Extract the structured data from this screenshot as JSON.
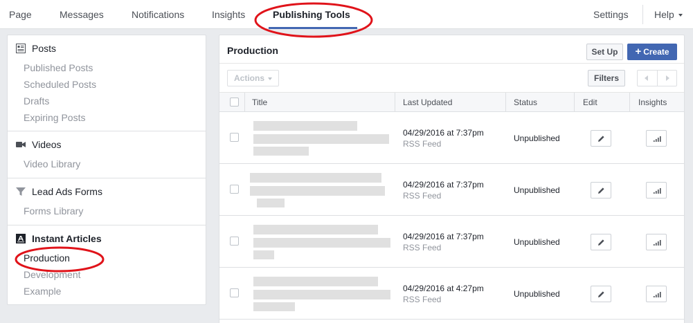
{
  "nav": {
    "page": "Page",
    "messages": "Messages",
    "notifications": "Notifications",
    "insights": "Insights",
    "publishing_tools": "Publishing Tools",
    "settings": "Settings",
    "help": "Help"
  },
  "sidebar": {
    "posts": {
      "title": "Posts",
      "items": [
        "Published Posts",
        "Scheduled Posts",
        "Drafts",
        "Expiring Posts"
      ]
    },
    "videos": {
      "title": "Videos",
      "items": [
        "Video Library"
      ]
    },
    "lead_ads": {
      "title": "Lead Ads Forms",
      "items": [
        "Forms Library"
      ]
    },
    "instant_articles": {
      "title": "Instant Articles",
      "items": [
        "Production",
        "Development",
        "Example"
      ]
    }
  },
  "panel": {
    "title": "Production",
    "setup_label": "Set Up",
    "create_label": "Create",
    "create_icon": "+",
    "actions_label": "Actions",
    "filters_label": "Filters"
  },
  "table": {
    "columns": {
      "title": "Title",
      "last_updated": "Last Updated",
      "status": "Status",
      "edit": "Edit",
      "insights": "Insights"
    },
    "rows": [
      {
        "date": "04/29/2016 at 7:37pm",
        "source": "RSS Feed",
        "status": "Unpublished"
      },
      {
        "date": "04/29/2016 at 7:37pm",
        "source": "RSS Feed",
        "status": "Unpublished"
      },
      {
        "date": "04/29/2016 at 7:37pm",
        "source": "RSS Feed",
        "status": "Unpublished"
      },
      {
        "date": "04/29/2016 at 4:27pm",
        "source": "RSS Feed",
        "status": "Unpublished"
      }
    ]
  },
  "colors": {
    "accent": "#4267b2",
    "annotation": "#e0131a"
  }
}
